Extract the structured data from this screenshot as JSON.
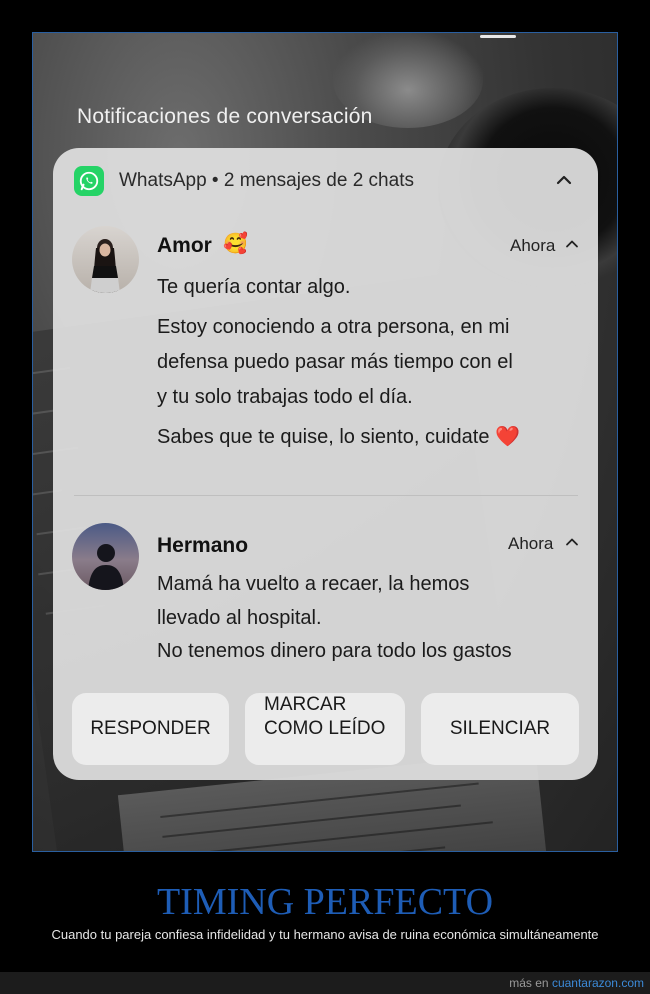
{
  "section_title": "Notificaciones de conversación",
  "notification": {
    "app_summary": "WhatsApp • 2 mensajes de 2 chats",
    "app_icon": "whatsapp-icon",
    "messages": [
      {
        "sender": "Amor",
        "emoji": "🥰",
        "time": "Ahora",
        "lines": [
          "Te quería contar algo.",
          "Estoy conociendo a otra persona, en mi",
          "defensa puedo pasar más tiempo con el",
          "y tu solo trabajas todo el día.",
          "Sabes que te quise, lo siento, cuidate ❤️"
        ]
      },
      {
        "sender": "Hermano",
        "time": "Ahora",
        "lines": [
          "Mamá ha vuelto a recaer, la hemos",
          "llevado al hospital.",
          "No tenemos dinero para todo los gastos"
        ]
      }
    ],
    "actions": {
      "reply": "RESPONDER",
      "mark_read_line1": "MARCAR",
      "mark_read_line2": "COMO LEÍDO",
      "mute": "SILENCIAR"
    }
  },
  "caption": {
    "title": "TIMING PERFECTO",
    "subtitle": "Cuando tu pareja confiesa infidelidad y tu hermano avisa de ruina económica simultáneamente"
  },
  "footer": {
    "prefix": "más en ",
    "site": "cuantarazon.com"
  },
  "colors": {
    "whatsapp_green": "#25d366",
    "caption_blue": "#1e5db6",
    "link_blue": "#3c8ad8"
  }
}
